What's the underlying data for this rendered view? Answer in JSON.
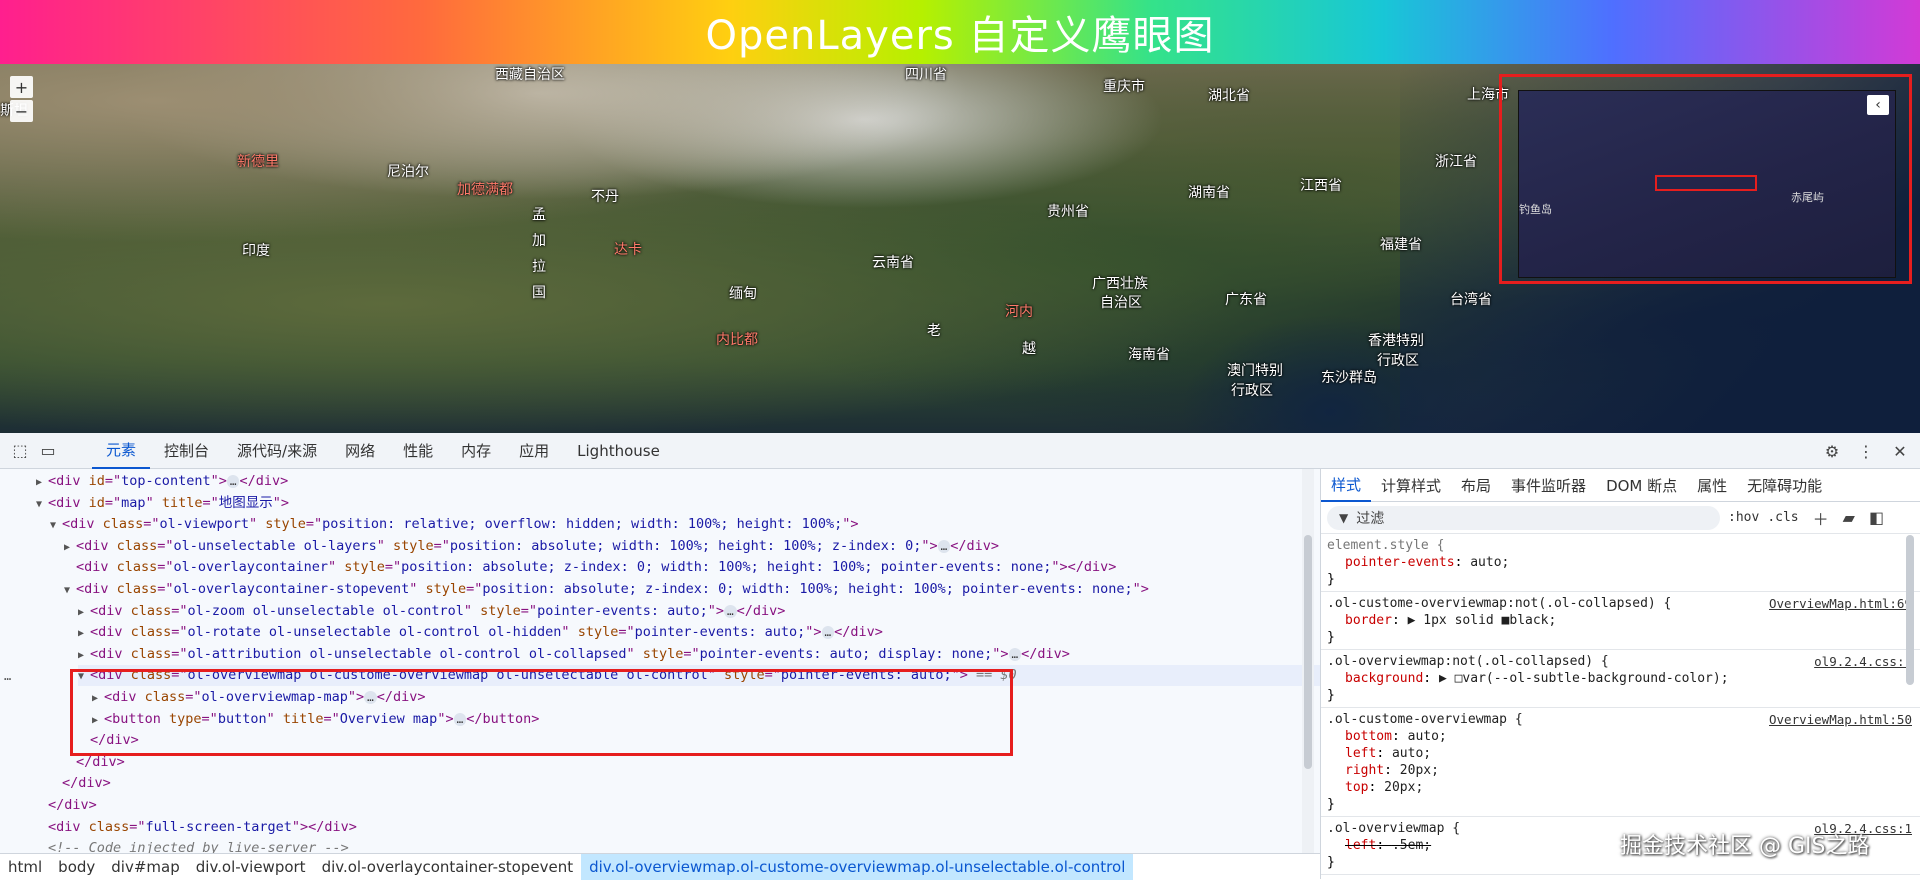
{
  "header": {
    "title": "OpenLayers 自定义鹰眼图"
  },
  "map": {
    "zoom_in": "+",
    "zoom_out": "−",
    "places": [
      {
        "text": "西藏自治区",
        "red": false
      },
      {
        "text": "四川省",
        "red": false
      },
      {
        "text": "重庆市",
        "red": false
      },
      {
        "text": "湖北省",
        "red": false
      },
      {
        "text": "上海市",
        "red": false
      },
      {
        "text": "斯坦",
        "red": false
      },
      {
        "text": "新德里",
        "red": true
      },
      {
        "text": "尼泊尔",
        "red": false
      },
      {
        "text": "加德满都",
        "red": true
      },
      {
        "text": "不丹",
        "red": false
      },
      {
        "text": "浙江省",
        "red": false
      },
      {
        "text": "江西省",
        "red": false
      },
      {
        "text": "湖南省",
        "red": false
      },
      {
        "text": "贵州省",
        "red": false
      },
      {
        "text": "福建省",
        "red": false
      },
      {
        "text": "孟加拉国",
        "red": false
      },
      {
        "text": "达卡",
        "red": true
      },
      {
        "text": "云南省",
        "red": false
      },
      {
        "text": "印度",
        "red": false
      },
      {
        "text": "广西壮族",
        "red": false
      },
      {
        "text": "自治区",
        "red": false
      },
      {
        "text": "广东省",
        "red": false
      },
      {
        "text": "台湾省",
        "red": false
      },
      {
        "text": "香港特别",
        "red": false
      },
      {
        "text": "行政区",
        "red": false
      },
      {
        "text": "缅甸",
        "red": false
      },
      {
        "text": "澳门特别",
        "red": false
      },
      {
        "text": "行政区",
        "red": false
      },
      {
        "text": "东沙群岛",
        "red": false
      },
      {
        "text": "河内",
        "red": true
      },
      {
        "text": "老",
        "red": false
      },
      {
        "text": "内比都",
        "red": true
      },
      {
        "text": "越",
        "red": false
      },
      {
        "text": "海南省",
        "red": false
      }
    ],
    "overview": {
      "button": "‹",
      "labels": [
        "赤尾屿",
        "钓鱼岛"
      ]
    }
  },
  "devtools": {
    "tabs": [
      "元素",
      "控制台",
      "源代码/来源",
      "网络",
      "性能",
      "内存",
      "应用",
      "Lighthouse"
    ],
    "active_tab": "元素",
    "elements": {
      "lines": [
        {
          "indent": 0,
          "tri": "▶",
          "parts": [
            [
              "tg",
              "<div "
            ],
            [
              "an",
              "id"
            ],
            [
              "tg",
              "=\""
            ],
            [
              "av",
              "top-content"
            ],
            [
              "tg",
              "\">"
            ],
            [
              "dots",
              "…"
            ],
            [
              "tg",
              "</div>"
            ]
          ]
        },
        {
          "indent": 0,
          "tri": "▼",
          "parts": [
            [
              "tg",
              "<div "
            ],
            [
              "an",
              "id"
            ],
            [
              "tg",
              "=\""
            ],
            [
              "av",
              "map"
            ],
            [
              "tg",
              "\" "
            ],
            [
              "an",
              "title"
            ],
            [
              "tg",
              "=\""
            ],
            [
              "av",
              "地图显示"
            ],
            [
              "tg",
              "\">"
            ]
          ]
        },
        {
          "indent": 1,
          "tri": "▼",
          "parts": [
            [
              "tg",
              "<div "
            ],
            [
              "an",
              "class"
            ],
            [
              "tg",
              "=\""
            ],
            [
              "av",
              "ol-viewport"
            ],
            [
              "tg",
              "\" "
            ],
            [
              "an",
              "style"
            ],
            [
              "tg",
              "=\""
            ],
            [
              "av",
              "position: relative; overflow: hidden; width: 100%; height: 100%;"
            ],
            [
              "tg",
              "\">"
            ]
          ]
        },
        {
          "indent": 2,
          "tri": "▶",
          "parts": [
            [
              "tg",
              "<div "
            ],
            [
              "an",
              "class"
            ],
            [
              "tg",
              "=\""
            ],
            [
              "av",
              "ol-unselectable ol-layers"
            ],
            [
              "tg",
              "\" "
            ],
            [
              "an",
              "style"
            ],
            [
              "tg",
              "=\""
            ],
            [
              "av",
              "position: absolute; width: 100%; height: 100%; z-index: 0;"
            ],
            [
              "tg",
              "\">"
            ],
            [
              "dots",
              "…"
            ],
            [
              "tg",
              "</div>"
            ]
          ]
        },
        {
          "indent": 2,
          "tri": "",
          "parts": [
            [
              "tg",
              "<div "
            ],
            [
              "an",
              "class"
            ],
            [
              "tg",
              "=\""
            ],
            [
              "av",
              "ol-overlaycontainer"
            ],
            [
              "tg",
              "\" "
            ],
            [
              "an",
              "style"
            ],
            [
              "tg",
              "=\""
            ],
            [
              "av",
              "position: absolute; z-index: 0; width: 100%; height: 100%; pointer-events: none;"
            ],
            [
              "tg",
              "\"></div>"
            ]
          ]
        },
        {
          "indent": 2,
          "tri": "▼",
          "parts": [
            [
              "tg",
              "<div "
            ],
            [
              "an",
              "class"
            ],
            [
              "tg",
              "=\""
            ],
            [
              "av",
              "ol-overlaycontainer-stopevent"
            ],
            [
              "tg",
              "\" "
            ],
            [
              "an",
              "style"
            ],
            [
              "tg",
              "=\""
            ],
            [
              "av",
              "position: absolute; z-index: 0; width: 100%; height: 100%; pointer-events: none;"
            ],
            [
              "tg",
              "\">"
            ]
          ]
        },
        {
          "indent": 3,
          "tri": "▶",
          "parts": [
            [
              "tg",
              "<div "
            ],
            [
              "an",
              "class"
            ],
            [
              "tg",
              "=\""
            ],
            [
              "av",
              "ol-zoom ol-unselectable ol-control"
            ],
            [
              "tg",
              "\" "
            ],
            [
              "an",
              "style"
            ],
            [
              "tg",
              "=\""
            ],
            [
              "av",
              "pointer-events: auto;"
            ],
            [
              "tg",
              "\">"
            ],
            [
              "dots",
              "…"
            ],
            [
              "tg",
              "</div>"
            ]
          ]
        },
        {
          "indent": 3,
          "tri": "▶",
          "parts": [
            [
              "tg",
              "<div "
            ],
            [
              "an",
              "class"
            ],
            [
              "tg",
              "=\""
            ],
            [
              "av",
              "ol-rotate ol-unselectable ol-control ol-hidden"
            ],
            [
              "tg",
              "\" "
            ],
            [
              "an",
              "style"
            ],
            [
              "tg",
              "=\""
            ],
            [
              "av",
              "pointer-events: auto;"
            ],
            [
              "tg",
              "\">"
            ],
            [
              "dots",
              "…"
            ],
            [
              "tg",
              "</div>"
            ]
          ]
        },
        {
          "indent": 3,
          "tri": "▶",
          "parts": [
            [
              "tg",
              "<div "
            ],
            [
              "an",
              "class"
            ],
            [
              "tg",
              "=\""
            ],
            [
              "av",
              "ol-attribution ol-unselectable ol-control ol-collapsed"
            ],
            [
              "tg",
              "\" "
            ],
            [
              "an",
              "style"
            ],
            [
              "tg",
              "=\""
            ],
            [
              "av",
              "pointer-events: auto; display: none;"
            ],
            [
              "tg",
              "\">"
            ],
            [
              "dots",
              "…"
            ],
            [
              "tg",
              "</div>"
            ]
          ]
        },
        {
          "indent": 3,
          "tri": "▼",
          "sel": true,
          "parts": [
            [
              "tg",
              "<div "
            ],
            [
              "an",
              "class"
            ],
            [
              "tg",
              "=\""
            ],
            [
              "av",
              "ol-overviewmap ol-custome-overviewmap ol-unselectable ol-control"
            ],
            [
              "tg",
              "\" "
            ],
            [
              "an",
              "style"
            ],
            [
              "tg",
              "=\""
            ],
            [
              "av",
              "pointer-events: auto;"
            ],
            [
              "tg",
              "\">"
            ],
            [
              "eq",
              " == $0"
            ]
          ]
        },
        {
          "indent": 4,
          "tri": "▶",
          "parts": [
            [
              "tg",
              "<div "
            ],
            [
              "an",
              "class"
            ],
            [
              "tg",
              "=\""
            ],
            [
              "av",
              "ol-overviewmap-map"
            ],
            [
              "tg",
              "\">"
            ],
            [
              "dots",
              "…"
            ],
            [
              "tg",
              "</div>"
            ]
          ]
        },
        {
          "indent": 4,
          "tri": "▶",
          "parts": [
            [
              "tg",
              "<button "
            ],
            [
              "an",
              "type"
            ],
            [
              "tg",
              "=\""
            ],
            [
              "av",
              "button"
            ],
            [
              "tg",
              "\" "
            ],
            [
              "an",
              "title"
            ],
            [
              "tg",
              "=\""
            ],
            [
              "av",
              "Overview map"
            ],
            [
              "tg",
              "\">"
            ],
            [
              "dots",
              "…"
            ],
            [
              "tg",
              "</button>"
            ]
          ]
        },
        {
          "indent": 3,
          "tri": "",
          "parts": [
            [
              "tg",
              "</div>"
            ]
          ]
        },
        {
          "indent": 2,
          "tri": "",
          "parts": [
            [
              "tg",
              "</div>"
            ]
          ]
        },
        {
          "indent": 1,
          "tri": "",
          "parts": [
            [
              "tg",
              "</div>"
            ]
          ]
        },
        {
          "indent": 0,
          "tri": "",
          "parts": [
            [
              "tg",
              "</div>"
            ]
          ]
        },
        {
          "indent": 0,
          "tri": "",
          "parts": [
            [
              "tg",
              "<div "
            ],
            [
              "an",
              "class"
            ],
            [
              "tg",
              "=\""
            ],
            [
              "av",
              "full-screen-target"
            ],
            [
              "tg",
              "\"></div>"
            ]
          ]
        },
        {
          "indent": 0,
          "tri": "",
          "parts": [
            [
              "eq",
              "<!-- Code injected by live-server -->"
            ]
          ]
        }
      ],
      "gutter_dots": "…"
    },
    "breadcrumbs": [
      "html",
      "body",
      "div#map",
      "div.ol-viewport",
      "div.ol-overlaycontainer-stopevent",
      "div.ol-overviewmap.ol-custome-overviewmap.ol-unselectable.ol-control"
    ],
    "styles_tabs": [
      "样式",
      "计算样式",
      "布局",
      "事件监听器",
      "DOM 断点",
      "属性",
      "无障碍功能"
    ],
    "filter": {
      "placeholder": "过滤",
      "hov": ":hov",
      "cls": ".cls"
    },
    "rules": [
      {
        "selector": "element.style {",
        "gray": true,
        "source": "",
        "decls": [
          {
            "prop": "pointer-events",
            "val": "auto;"
          }
        ]
      },
      {
        "selector": ".ol-custome-overviewmap:not(.ol-collapsed) {",
        "gray": false,
        "source": "OverviewMap.html:69",
        "decls": [
          {
            "prop": "border",
            "val": "▶ 1px solid ■black;"
          }
        ]
      },
      {
        "selector": ".ol-overviewmap:not(.ol-collapsed) {",
        "gray": false,
        "source": "ol9.2.4.css:1",
        "decls": [
          {
            "prop": "background",
            "val": "▶ □var(--ol-subtle-background-color);"
          }
        ]
      },
      {
        "selector": ".ol-custome-overviewmap {",
        "gray": false,
        "source": "OverviewMap.html:50",
        "decls": [
          {
            "prop": "bottom",
            "val": "auto;"
          },
          {
            "prop": "left",
            "val": "auto;"
          },
          {
            "prop": "right",
            "val": "20px;"
          },
          {
            "prop": "top",
            "val": "20px;"
          }
        ]
      },
      {
        "selector": ".ol-overviewmap {",
        "gray": false,
        "source": "ol9.2.4.css:1",
        "decls": [
          {
            "prop": "left",
            "val": ".5em;",
            "strike": true
          }
        ]
      }
    ]
  },
  "watermark": "掘金技术社区 @ GIS之路"
}
